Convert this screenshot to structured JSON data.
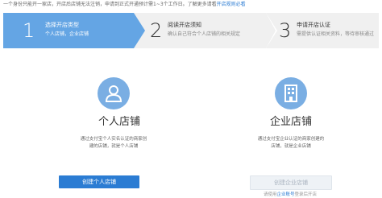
{
  "notice": {
    "text": "一个身份只能开一家店，开店后店铺无法注销，申请到正式开通预计需1~3个工作日。了解更多请看",
    "link": "开店规则必看"
  },
  "steps": [
    {
      "num": "1",
      "title": "选择开店类型",
      "desc": "个人店铺，企业店铺"
    },
    {
      "num": "2",
      "title": "阅读开店须知",
      "desc": "确认自己符合个人店铺的相关规定"
    },
    {
      "num": "3",
      "title": "申请开店认证",
      "desc": "需提供认证相关资料，等待审核通过"
    }
  ],
  "personal": {
    "title": "个人店铺",
    "desc": "通过支付宝个人实名认证的商家创建的店铺，就是个人店铺",
    "button": "创建个人店铺"
  },
  "company": {
    "title": "企业店铺",
    "desc": "通过支付宝企业认证的商家创建的店铺，就是企业店铺",
    "button": "创建企业店铺",
    "note_prefix": "请使用",
    "note_link": "企业账号",
    "note_suffix": "登录后开店"
  },
  "colors": {
    "accent": "#2b7cd3",
    "step_active": "#64a5e4",
    "icon_bg": "#7aaee3"
  }
}
